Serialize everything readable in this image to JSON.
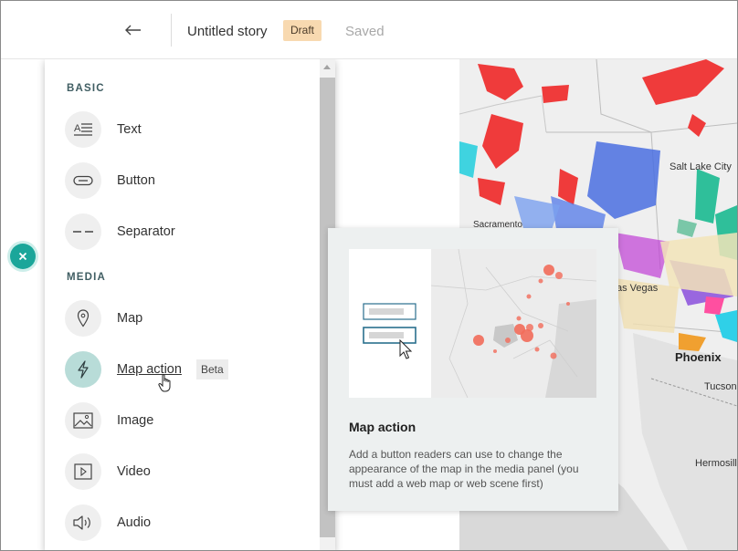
{
  "header": {
    "back_icon": "arrow-left-icon",
    "title": "Untitled story",
    "status_badge": "Draft",
    "save_status": "Saved"
  },
  "palette": {
    "sections": [
      {
        "label": "BASIC",
        "items": [
          {
            "label": "Text",
            "icon": "text-icon"
          },
          {
            "label": "Button",
            "icon": "button-icon"
          },
          {
            "label": "Separator",
            "icon": "separator-icon"
          }
        ]
      },
      {
        "label": "MEDIA",
        "items": [
          {
            "label": "Map",
            "icon": "map-pin-icon"
          },
          {
            "label": "Map action",
            "icon": "lightning-icon",
            "badge": "Beta"
          },
          {
            "label": "Image",
            "icon": "image-icon"
          },
          {
            "label": "Video",
            "icon": "video-icon"
          },
          {
            "label": "Audio",
            "icon": "audio-icon"
          }
        ]
      }
    ]
  },
  "tooltip": {
    "title": "Map action",
    "description": "Add a button readers can use to change the appearance of the map in the media panel (you must add a web map or web scene first)"
  },
  "map": {
    "labels": [
      "Sacramento",
      "Salt Lake City",
      "as Vegas",
      "Phoenix",
      "Tucson",
      "Hermosill"
    ]
  },
  "colors": {
    "accent": "#1ba69a",
    "draft_badge": "#f8d9b0",
    "active_icon_bg": "#b8dcd8",
    "section_label": "#3f5d62"
  }
}
